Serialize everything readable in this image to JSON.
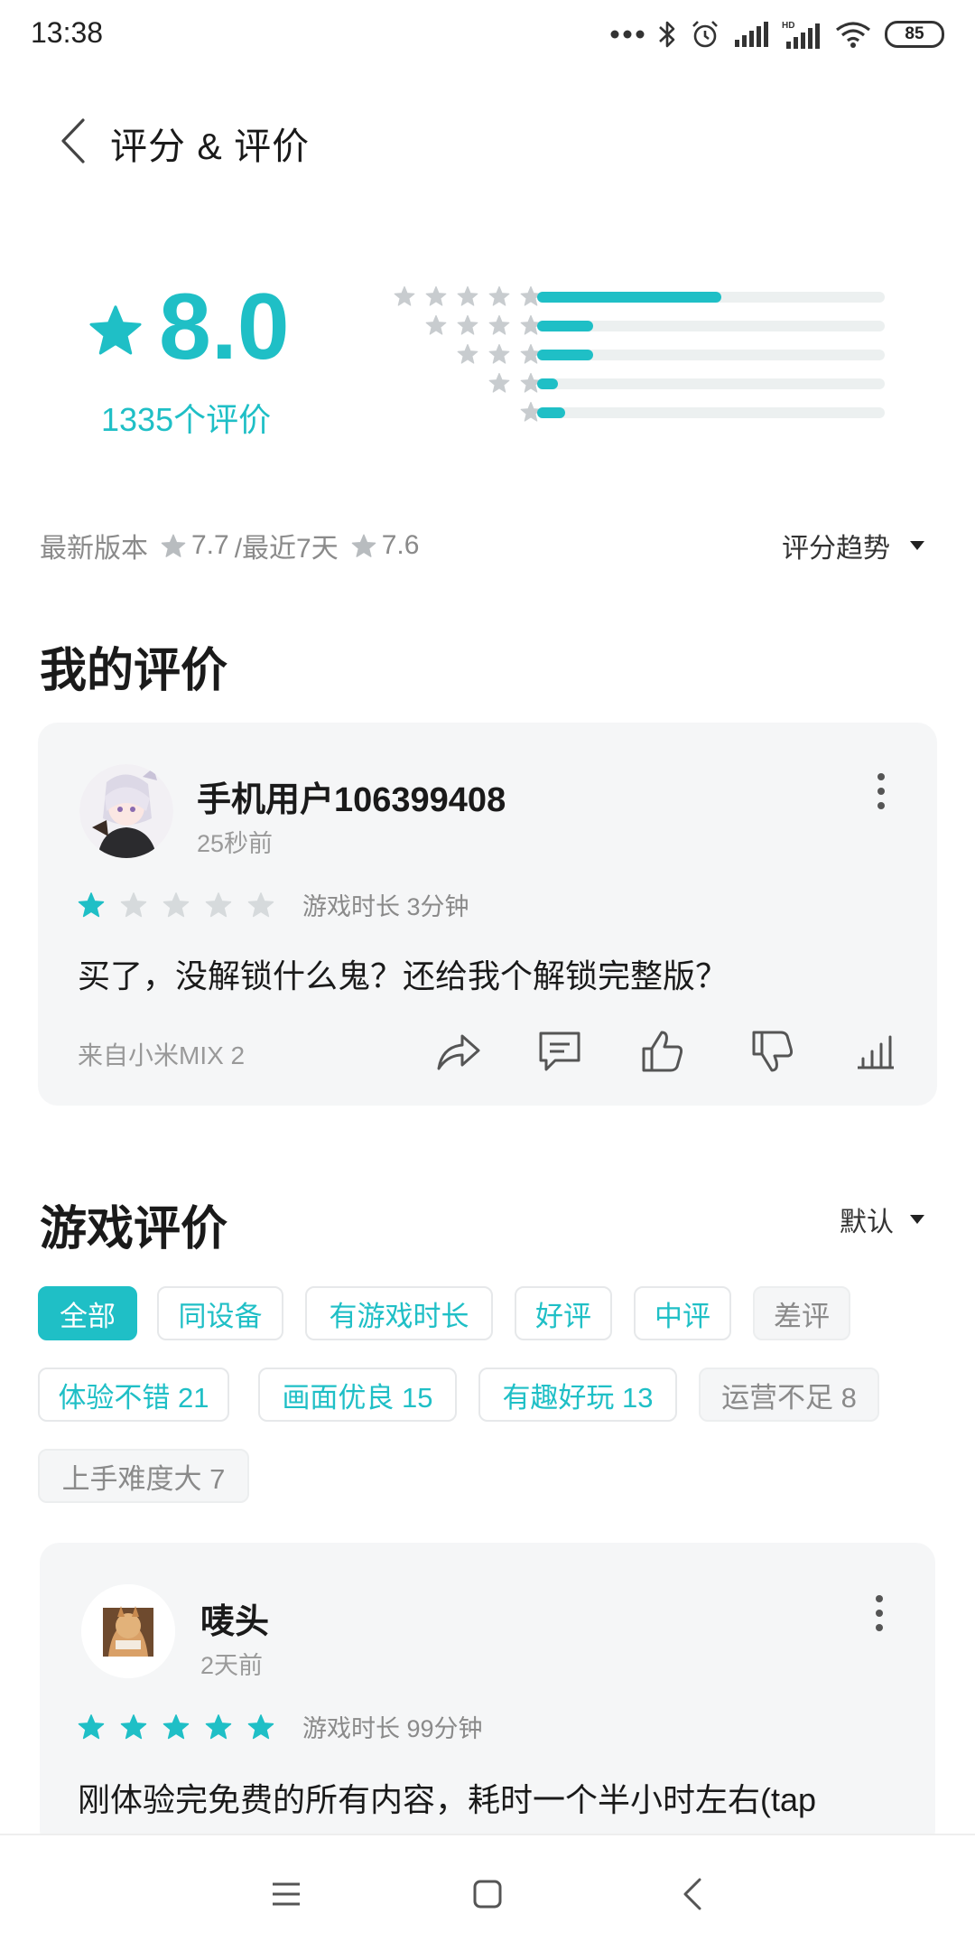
{
  "status_bar": {
    "time": "13:38",
    "battery": "85",
    "icons": [
      "more-dots-icon",
      "bluetooth-icon",
      "alarm-icon",
      "signal-icon",
      "hd-signal-icon",
      "wifi-icon",
      "battery-icon"
    ]
  },
  "header": {
    "title": "评分 & 评价",
    "back_icon": "chevron-left-icon"
  },
  "summary": {
    "score": "8.0",
    "count_text": "1335个评价",
    "distribution": [
      {
        "stars": 5,
        "fraction": 0.53
      },
      {
        "stars": 4,
        "fraction": 0.16
      },
      {
        "stars": 3,
        "fraction": 0.16
      },
      {
        "stars": 2,
        "fraction": 0.06
      },
      {
        "stars": 1,
        "fraction": 0.08
      }
    ],
    "latest_label": "最新版本",
    "latest_score": "7.7",
    "recent_label": "/最近7天",
    "recent_score": "7.6",
    "trend_label": "评分趋势"
  },
  "my_review": {
    "section_title": "我的评价",
    "username": "手机用户106399408",
    "time": "25秒前",
    "rating": 1,
    "playtime": "游戏时长 3分钟",
    "text": "买了，没解锁什么鬼？还给我个解锁完整版？",
    "device": "来自小米MIX 2",
    "actions": [
      "share-icon",
      "comment-icon",
      "thumbs-up-icon",
      "thumbs-down-icon",
      "stats-icon"
    ]
  },
  "game_reviews": {
    "section_title": "游戏评价",
    "sort_label": "默认",
    "chips": [
      {
        "label": "全部",
        "state": "active"
      },
      {
        "label": "同设备",
        "state": "normal"
      },
      {
        "label": "有游戏时长",
        "state": "normal"
      },
      {
        "label": "好评",
        "state": "normal"
      },
      {
        "label": "中评",
        "state": "normal"
      },
      {
        "label": "差评",
        "state": "neg"
      },
      {
        "label": "体验不错 21",
        "state": "normal"
      },
      {
        "label": "画面优良 15",
        "state": "normal"
      },
      {
        "label": "有趣好玩 13",
        "state": "normal"
      },
      {
        "label": "运营不足 8",
        "state": "neg"
      },
      {
        "label": "上手难度大 7",
        "state": "neg"
      }
    ],
    "review": {
      "username": "唛头",
      "time": "2天前",
      "rating": 5,
      "playtime": "游戏时长 99分钟",
      "text": "刚体验完免费的所有内容，耗时一个半小时左右(tap"
    }
  },
  "colors": {
    "accent": "#1fbfc6",
    "star_gray": "#c8cccf",
    "card_bg": "#f5f6f7"
  },
  "nav_bar": {
    "icons": [
      "menu-icon",
      "home-square-icon",
      "back-triangle-icon"
    ]
  }
}
